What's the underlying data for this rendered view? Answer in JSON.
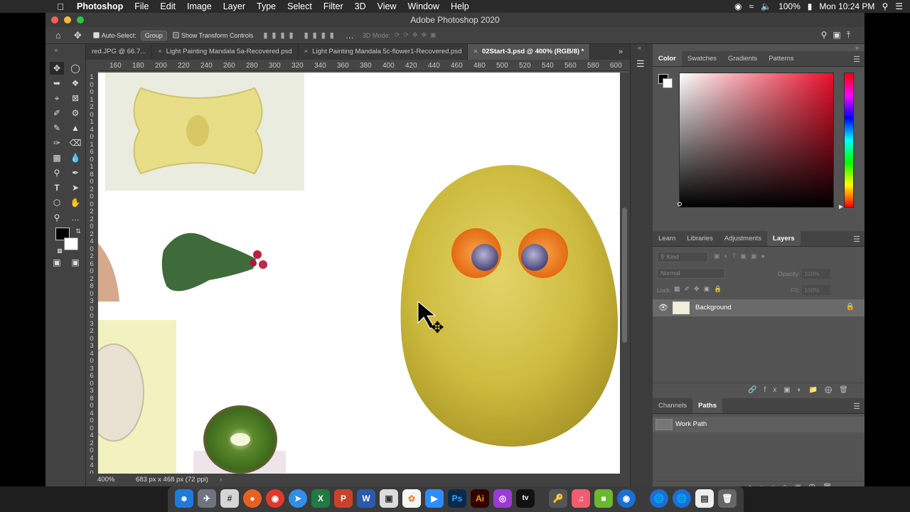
{
  "menubar": {
    "app_name": "Photoshop",
    "items": [
      "File",
      "Edit",
      "Image",
      "Layer",
      "Type",
      "Select",
      "Filter",
      "3D",
      "View",
      "Window",
      "Help"
    ],
    "battery": "100%",
    "clock": "Mon 10:24 PM"
  },
  "window": {
    "title": "Adobe Photoshop 2020"
  },
  "options": {
    "auto_select_label": "Auto-Select:",
    "auto_select_value": "Group",
    "transform_label": "Show Transform Controls",
    "mode_3d": "3D Mode:"
  },
  "tabs": [
    {
      "label": "red.JPG @ 66.7..."
    },
    {
      "label": "Light Painting Mandala 5a-Recovered.psd"
    },
    {
      "label": "Light Painting Mandala 5c-flower1-Recovered.psd"
    },
    {
      "label": "02Start-3.psd @ 400% (RGB/8) *"
    }
  ],
  "ruler": {
    "h_ticks": [
      "160",
      "180",
      "200",
      "220",
      "240",
      "260",
      "280",
      "300",
      "320",
      "340",
      "360",
      "380",
      "400",
      "420",
      "440",
      "460",
      "480",
      "500",
      "520",
      "540",
      "560",
      "580",
      "600"
    ],
    "v_ticks": [
      "1",
      "0",
      "0",
      "1",
      "2",
      "0",
      "1",
      "4",
      "0",
      "1",
      "6",
      "0",
      "1",
      "8",
      "0",
      "2",
      "0",
      "0",
      "2",
      "2",
      "0",
      "2",
      "4",
      "0",
      "2",
      "6",
      "0",
      "2",
      "8",
      "0",
      "3",
      "0",
      "0",
      "3",
      "2",
      "0",
      "3",
      "4",
      "0",
      "3",
      "6",
      "0",
      "3",
      "8",
      "0",
      "4",
      "0",
      "0",
      "4",
      "2",
      "0",
      "4",
      "4",
      "0"
    ]
  },
  "status": {
    "zoom": "400%",
    "doc_info": "683 px x 468 px (72 ppi)"
  },
  "color_panel": {
    "tabs": [
      "Color",
      "Swatches",
      "Gradients",
      "Patterns"
    ],
    "active": "Color",
    "hue_color": "#e8102a"
  },
  "layers_panel": {
    "tabs": [
      "Learn",
      "Libraries",
      "Adjustments",
      "Layers"
    ],
    "active": "Layers",
    "filter": "Kind",
    "blend_mode": "Normal",
    "opacity_label": "Opacity:",
    "opacity_value": "100%",
    "lock_label": "Lock:",
    "fill_label": "Fill:",
    "fill_value": "100%",
    "layers": [
      {
        "name": "Background",
        "visible": true,
        "locked": true
      }
    ]
  },
  "paths_panel": {
    "tabs": [
      "Channels",
      "Paths"
    ],
    "active": "Paths",
    "paths": [
      {
        "name": "Work Path"
      }
    ]
  },
  "colors": {
    "foreground": "#000000",
    "background": "#ffffff"
  }
}
